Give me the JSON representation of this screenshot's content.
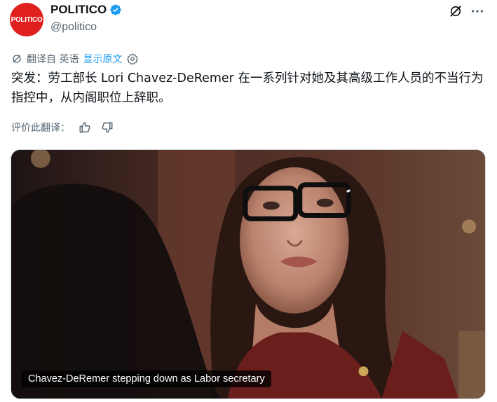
{
  "author": {
    "avatar_text": "POLITICO",
    "display_name": "POLITICO",
    "handle": "@politico"
  },
  "translation": {
    "source_label": "翻译自 英语",
    "show_original": "显示原文"
  },
  "tweet": {
    "text": "突发：劳工部长 Lori Chavez-DeRemer 在一系列针对她及其高级工作人员的不当行为指控中，从内阁职位上辞职。"
  },
  "rate": {
    "label": "评价此翻译："
  },
  "media": {
    "caption": "Chavez-DeRemer stepping down as Labor secretary"
  },
  "colors": {
    "brand_red": "#e0201f",
    "link_blue": "#1d9bf0",
    "muted_gray": "#536471"
  },
  "icons": [
    "verified-badge-icon",
    "grok-icon",
    "more-icon",
    "translate-icon",
    "settings-gear-icon",
    "thumbs-up-icon",
    "thumbs-down-icon"
  ]
}
